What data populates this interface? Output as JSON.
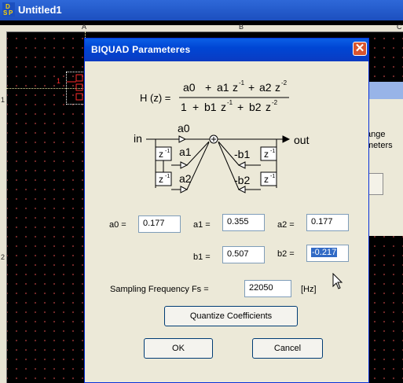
{
  "app": {
    "title": "Untitled1",
    "icon_name": "dsp-app-icon"
  },
  "ruler": {
    "columns": [
      "A",
      "B",
      "C"
    ],
    "rows": [
      "1",
      "2"
    ]
  },
  "schematic": {
    "pin_label": "1"
  },
  "back_dialog": {
    "line1": "ange",
    "line2": "meters"
  },
  "dialog": {
    "title": "BIQUAD Parameteres",
    "close_icon": "close-icon",
    "formula": {
      "lhs": "H (z) =",
      "numerator": {
        "a0": "a0",
        "a1": "a1",
        "z1": "z",
        "exp1": "-1",
        "a2": "a2",
        "z2": "z",
        "exp2": "-2"
      },
      "denominator": {
        "one": "1",
        "b1": "b1",
        "z1": "z",
        "exp1": "-1",
        "b2": "b2",
        "z2": "z",
        "exp2": "-2"
      }
    },
    "diagram": {
      "in": "in",
      "out": "out",
      "a0": "a0",
      "a1": "a1",
      "a2": "a2",
      "nb1": "-b1",
      "nb2": "-b2",
      "delay": "z",
      "delay_exp": "-1"
    },
    "fields": {
      "a0": {
        "label": "a0 =",
        "value": "0.177"
      },
      "a1": {
        "label": "a1 =",
        "value": "0.355"
      },
      "a2": {
        "label": "a2 =",
        "value": "0.177"
      },
      "b1": {
        "label": "b1 =",
        "value": "0.507"
      },
      "b2": {
        "label": "b2 =",
        "value": "-0.217"
      }
    },
    "fs": {
      "label": "Sampling Frequency Fs =",
      "value": "22050",
      "unit": "[Hz]"
    },
    "buttons": {
      "quantize": "Quantize Coefficients",
      "ok": "OK",
      "cancel": "Cancel"
    }
  }
}
